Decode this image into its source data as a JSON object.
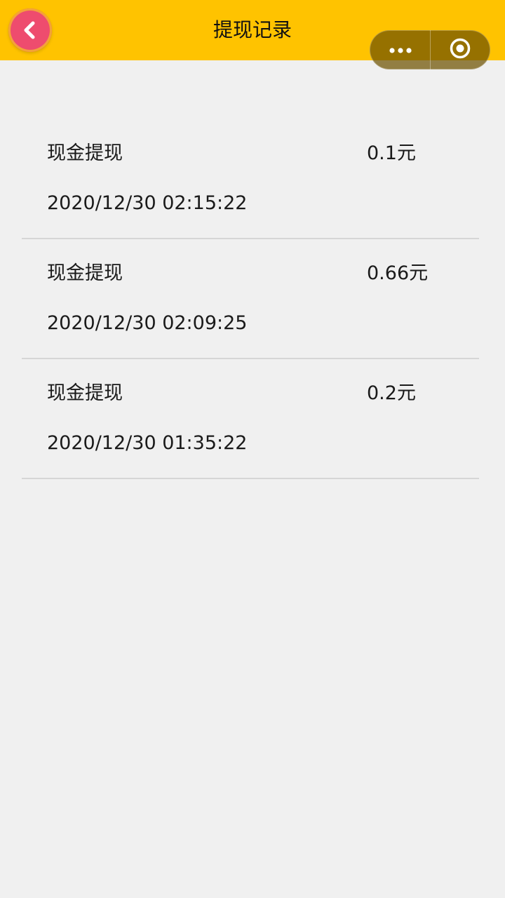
{
  "header": {
    "title": "提现记录",
    "background_color": "#ffc300",
    "back_icon": "chevron-left-icon",
    "menu_icon": "more-dots-icon",
    "close_icon": "target-circle-icon"
  },
  "records": [
    {
      "type": "现金提现",
      "amount": "0.1元",
      "time": "2020/12/30 02:15:22"
    },
    {
      "type": "现金提现",
      "amount": "0.66元",
      "time": "2020/12/30 02:09:25"
    },
    {
      "type": "现金提现",
      "amount": "0.2元",
      "time": "2020/12/30 01:35:22"
    }
  ]
}
